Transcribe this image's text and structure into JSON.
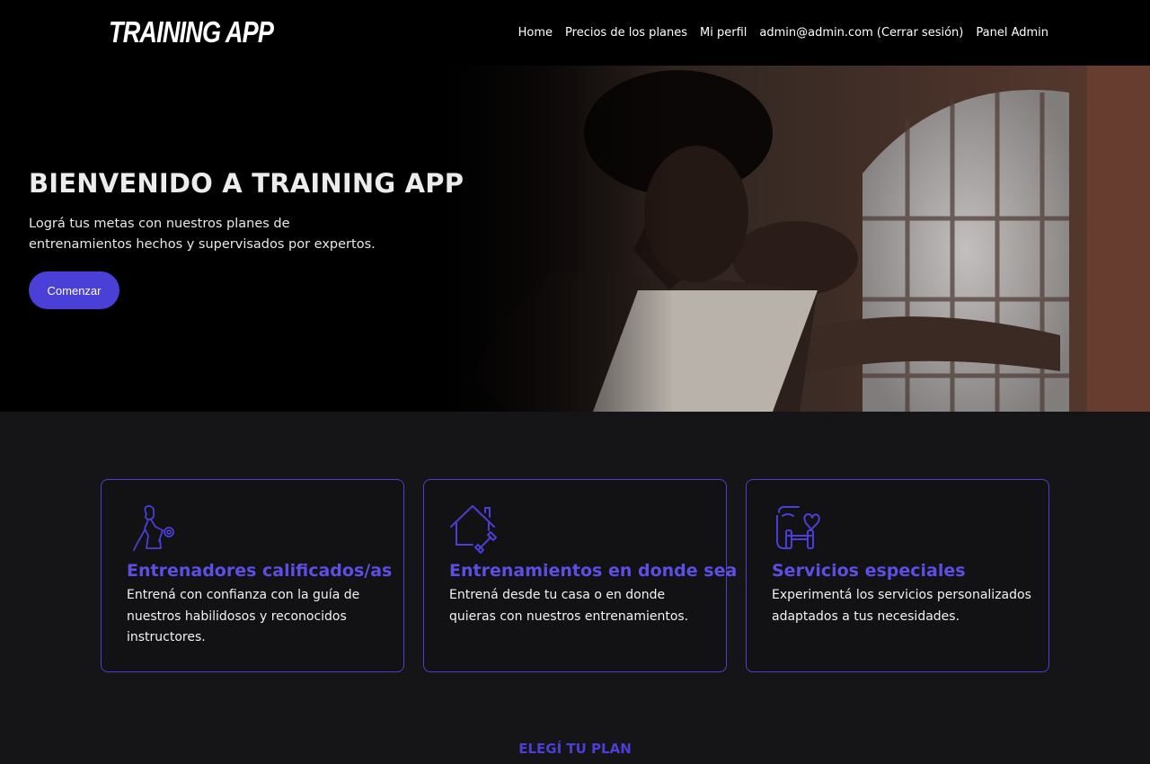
{
  "header": {
    "logo": "TRAINING APP",
    "nav": [
      {
        "label": "Home"
      },
      {
        "label": "Precios de los planes"
      },
      {
        "label": "Mi perfil"
      },
      {
        "label": "admin@admin.com (Cerrar sesión)"
      },
      {
        "label": "Panel Admin"
      }
    ]
  },
  "hero": {
    "title": "BIENVENIDO A TRAINING APP",
    "subtitle": "Lográ tus metas con nuestros planes de entrenamientos hechos y supervisados por expertos.",
    "cta_label": "Comenzar"
  },
  "features": [
    {
      "icon": "trainer-icon",
      "title": "Entrenadores calificados/as",
      "text": "Entrená con confianza con la guía de nuestros habilidosos y reconocidos instructores."
    },
    {
      "icon": "home-dumbbell-icon",
      "title": "Entrenamientos en donde sea",
      "text": "Entrená desde tu casa o en donde quieras con nuestros entrenamientos."
    },
    {
      "icon": "special-services-icon",
      "title": "Servicios especiales",
      "text": "Experimentá los servicios personalizados adaptados a tus necesidades."
    }
  ],
  "plans": {
    "heading": "ELEGÍ TU PLAN"
  },
  "colors": {
    "accent": "#4a3fd6",
    "accent_text": "#5b4fe6",
    "page_bg": "#151416",
    "nav_bg": "#000000"
  }
}
